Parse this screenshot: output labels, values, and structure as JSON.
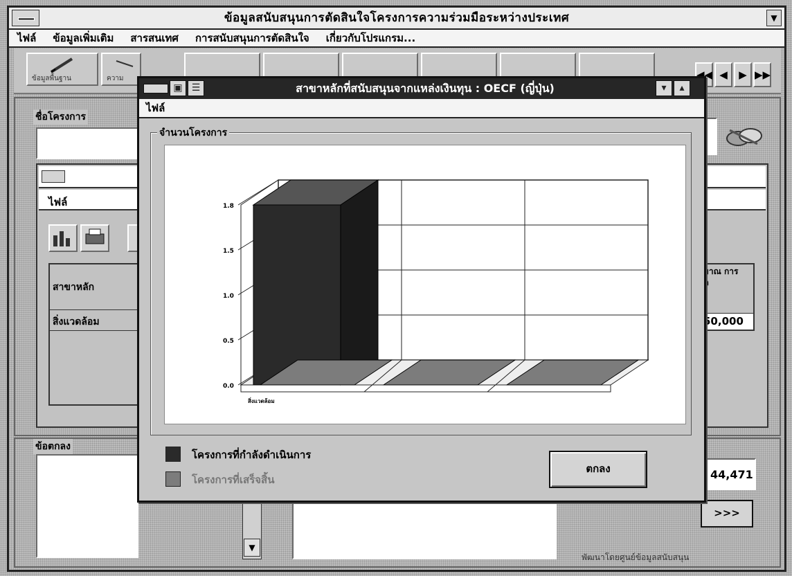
{
  "window": {
    "title": "ข้อมูลสนับสนุนการตัดสินใจโครงการความร่วมมือระหว่างประเทศ",
    "menu": [
      "ไฟล์",
      "ข้อมูลเพิ่มเติม",
      "สารสนเทศ",
      "การสนับสนุนการตัดสินใจ",
      "เกี่ยวกับโปรแกรม..."
    ]
  },
  "toolbar": {
    "buttons": [
      {
        "label": "ข้อมูลพื้นฐาน",
        "icon": "pen-icon"
      },
      {
        "label": "ความ",
        "icon": "scissors-icon"
      }
    ],
    "nav": [
      "◀◀",
      "◀",
      "▶",
      "▶▶"
    ]
  },
  "left_panel": {
    "project_name_label": "ชื่อโครงการ",
    "inner_menu": "ไฟล์",
    "table_rows": [
      "สาขาหลัก",
      "สิ่งแวดล้อม"
    ]
  },
  "right_panel": {
    "budget_header": "มาณ การ ด",
    "budget_value": "50,000",
    "total_value": "44,471",
    "more_button": ">>>",
    "footer_text": "พัฒนาโดยศูนย์ข้อมูลสนับสนุน"
  },
  "agreement_label": "ข้อตกลง",
  "dialog": {
    "title": "สาขาหลักที่สนับสนุนจากแหล่งเงินทุน : OECF (ญี่ปุ่น)",
    "menu": "ไฟล์",
    "group_label": "จำนวนโครงการ",
    "legend": [
      {
        "label": "โครงการที่กำลังดำเนินการ",
        "color": "#2a2a2a"
      },
      {
        "label": "โครงการที่เสร็จสิ้น",
        "color": "#7c7c7c"
      }
    ],
    "ok_label": "ตกลง"
  },
  "chart_data": {
    "type": "bar",
    "categories": [
      "สิ่งแวดล้อม",
      "",
      ""
    ],
    "series": [
      {
        "name": "โครงการที่กำลังดำเนินการ",
        "values": [
          1.8,
          0,
          0
        ]
      },
      {
        "name": "โครงการที่เสร็จสิ้น",
        "values": [
          0,
          0,
          0
        ]
      }
    ],
    "y_ticks": [
      "1.8",
      "1.5",
      "1.0",
      "0.5",
      "0.0"
    ],
    "ylim": [
      0,
      1.8
    ],
    "grid": true,
    "colors": {
      "active": "#2a2a2a",
      "finished": "#7c7c7c"
    }
  }
}
